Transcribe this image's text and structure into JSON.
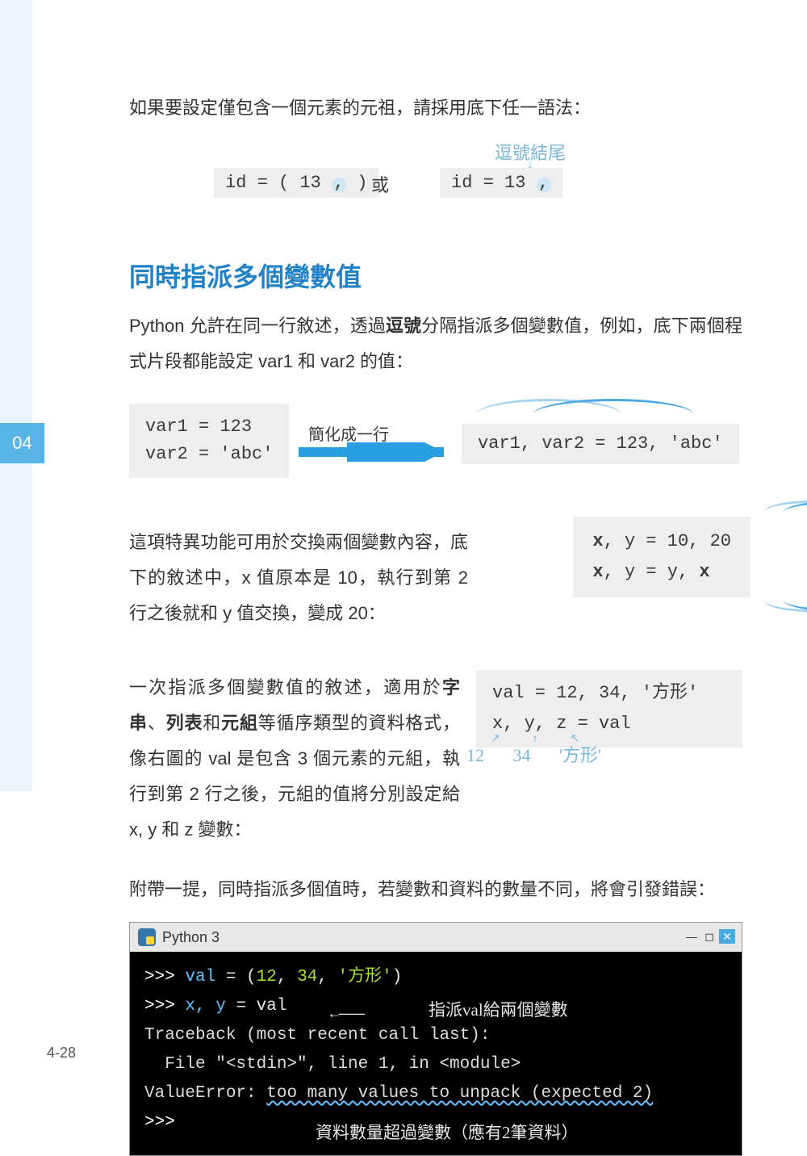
{
  "chapter_badge": "04",
  "page_number": "4-28",
  "intro_para": "如果要設定僅包含一個元素的元祖，請採用底下任一語法：",
  "example1": {
    "code_left_pre": "id = ( 13 ",
    "code_left_comma": ",",
    "code_left_post": " )",
    "or": "或",
    "code_right_pre": "id = 13 ",
    "code_right_comma": ",",
    "annotation": "逗號結尾"
  },
  "heading": "同時指派多個變數值",
  "para2_a": "Python 允許在同一行敘述，透過",
  "para2_bold": "逗號",
  "para2_b": "分隔指派多個變數值，例如，底下兩個程式片段都能設定 var1 和 var2 的值：",
  "example2": {
    "left_line1": "var1 = 123",
    "left_line2": "var2 = 'abc'",
    "label": "簡化成一行",
    "right": "var1, var2 = 123, 'abc'"
  },
  "para3": "這項特異功能可用於交換兩個變數內容，底下的敘述中，x 值原本是 10，執行到第 2 行之後就和 y 值交換，變成 20：",
  "example3": {
    "line1_a": "x",
    "line1_b": ", y = 10, 20",
    "line2_a": "x",
    "line2_b": ", y = y, ",
    "line2_c": "x"
  },
  "para4_a": "一次指派多個變數值的敘述，適用於",
  "para4_b1": "字串",
  "para4_sep1": "、",
  "para4_b2": "列表",
  "para4_sep2": "和",
  "para4_b3": "元組",
  "para4_c": "等循序類型的資料格式，像右圖的 val 是包含 3 個元素的元組，執行到第 2 行之後，元組的值將分別設定給 x, y 和 z 變數：",
  "example4": {
    "line1": "val = 12, 34, '方形'",
    "line2": "x, y, z = val",
    "arrows": "↗ ↑ ↖",
    "anno": "12  34  '方形'"
  },
  "para5": "附帶一提，同時指派多個值時，若變數和資料的數量不同，將會引發錯誤：",
  "terminal": {
    "title": "Python 3",
    "l1_prompt": ">>> ",
    "l1_code": "val = (12, 34, '方形')",
    "l2_prompt": ">>> ",
    "l2_code": "x, y = val",
    "anno1_arrow": "←———",
    "anno1": "指派val給兩個變數",
    "l3": "Traceback (most recent call last):",
    "l4": "  File \"<stdin>\", line 1, in <module>",
    "l5_pre": "ValueError: ",
    "l5_err": "too many values to unpack (expected 2)",
    "l6_prompt": ">>>",
    "anno2": "資料數量超過變數（應有2筆資料）"
  }
}
